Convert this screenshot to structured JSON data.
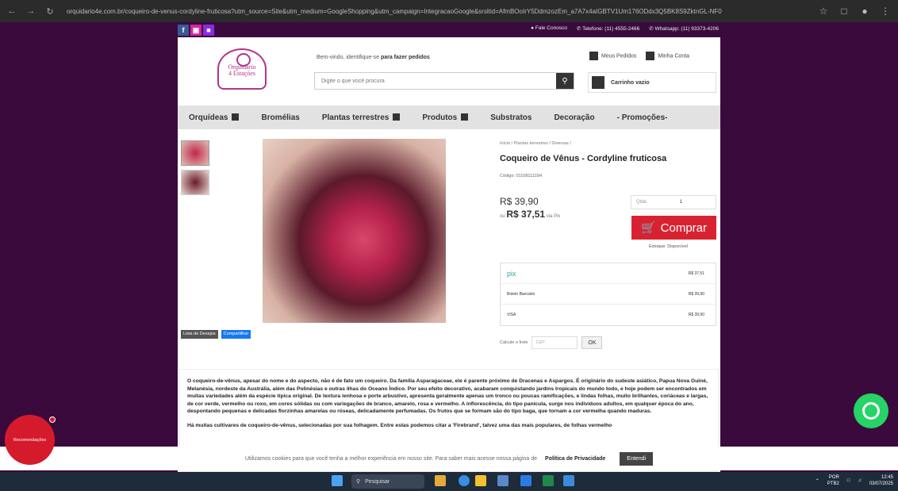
{
  "browser": {
    "url": "orquidario4e.com.br/coqueiro-de-venus-cordyline-fruticosa?utm_source=Site&utm_medium=GoogleShopping&utm_campaign=IntegracaoGoogle&srsltid=AfmBOoIrY5DdmzozEm_a7A7x4aIGBTV1Um176ODdx3Q5BK8S9ZktnGL-NF0",
    "domain": "orquidario4e.com.br"
  },
  "topbar": {
    "social": [
      "f",
      "▣",
      "■"
    ],
    "contact_us": "Fale Conosco",
    "phone": "Telefone: (11) 4555-2466",
    "whatsapp": "Whatsapp: (11) 93373-4206"
  },
  "header": {
    "logo_line1": "Orquidário",
    "logo_line2": "4 Estações",
    "welcome": "Bem-vindo, identifique-se",
    "welcome_link": "para fazer pedidos",
    "my_orders": "Meus Pedidos",
    "my_account": "Minha Conta",
    "search_placeholder": "Digite o que você procura",
    "cart": "Carrinho vazio"
  },
  "menu": [
    {
      "label": "Orquídeas"
    },
    {
      "label": "Bromélias"
    },
    {
      "label": "Plantas terrestres"
    },
    {
      "label": "Produtos"
    },
    {
      "label": "Substratos"
    },
    {
      "label": "Decoração"
    },
    {
      "label": "- Promoções-"
    }
  ],
  "product": {
    "breadcrumb": "Início / Plantas terrestres / Diversas /",
    "title": "Coqueiro de Vênus - Cordyline fruticosa",
    "code": "Código: 0110811119H",
    "price": "R$ 39,90",
    "pix_prefix": "ou",
    "pix_price": "R$ 37,51",
    "pix_suffix": "via Pix",
    "qty_label": "Qtde.",
    "qty_value": "1",
    "buy_label": "Comprar",
    "stock": "Estoque: Disponível",
    "wishlist": "Lista de Desejos",
    "share": "Compartilhar"
  },
  "payment": [
    {
      "method": "pix",
      "value": "R$ 37,51"
    },
    {
      "method": "Boleto Bancário",
      "value": "R$ 39,90"
    },
    {
      "method": "VISA",
      "value": "R$ 39,90"
    }
  ],
  "shipping": {
    "label": "Calcule o frete",
    "placeholder": "CEP",
    "button": "OK"
  },
  "description": {
    "p1": "O coqueiro-de-vênus, apesar do nome e do aspecto, não é de fato um coqueiro. Da família Asparagaceae, ele é parente próximo de Dracenas e Aspargos. É originário do sudeste asiático, Papua Nova Guiné, Melanésia, nordeste da Austrália, além das Polinésias e outras ilhas do Oceano Índico. Por seu efeito decorativo, acabaram conquistando jardins tropicais do mundo todo, e hoje podem ser encontrados em muitas variedades além da espécie típica original. De textura lenhosa e porte arbustivo, apresenta geralmente apenas um tronco ou poucas ramificações, e lindas folhas, muito brilhantes, coriáceas e largas, de cor verde, vermelho ou roxo, em cores sólidas ou com variegações de branco, amarelo, rosa e vermelho. A inflorescência, do tipo panícula, surge nos indivíduos adultos, em qualquer época do ano, despontando pequenas e delicadas florzinhas amarelas ou róseas, delicadamente perfumadas. Os frutos que se formam são do tipo baga, que tornam a cor vermelha quando maduras.",
    "p2": "Há muitas cultivares de coqueiro-de-vênus, selecionadas por sua folhagem. Entre estas podemos citar a 'Firebrand', talvez uma das mais populares, de folhas vermelho"
  },
  "cookie": {
    "text": "Utilizamos cookies para que você tenha a melhor experiência em nosso site. Para saber mais acesse nossa página de",
    "link": "Política de Privacidade",
    "button": "Entendi"
  },
  "recommendations": "Recomendações",
  "taskbar": {
    "search": "Pesquisar",
    "lang1": "POR",
    "lang2": "PTB2",
    "time": "12:45",
    "date": "03/07/2025"
  },
  "colors": {
    "brand_purple": "#3a0a3d",
    "buy_red": "#d92231",
    "whatsapp_green": "#25d366"
  }
}
